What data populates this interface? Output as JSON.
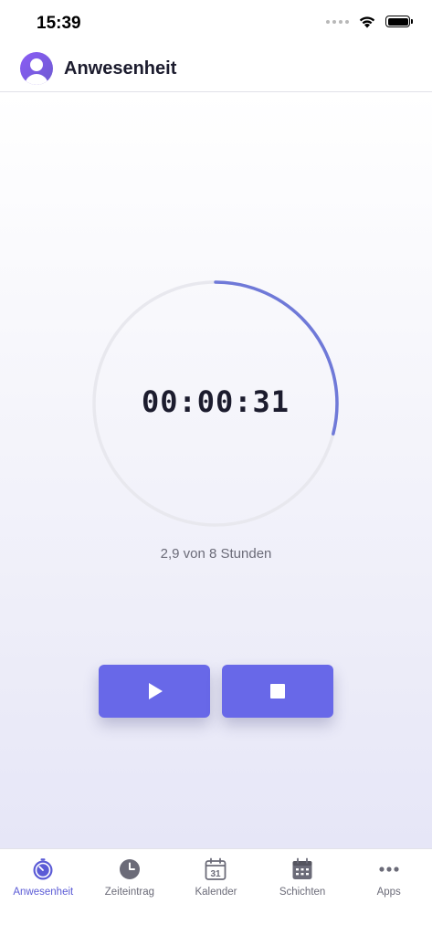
{
  "status_bar": {
    "time": "15:39"
  },
  "header": {
    "title": "Anwesenheit",
    "avatar_icon": "user-avatar-icon"
  },
  "timer": {
    "elapsed": "00:00:31",
    "progress_text": "2,9 von 8 Stunden",
    "ring_progress_fraction": 0.29,
    "ring_color": "#6f79d8",
    "track_color": "#e8e8ee"
  },
  "controls": {
    "play_icon": "play-icon",
    "stop_icon": "stop-icon",
    "button_color": "#6868e8"
  },
  "tabs": [
    {
      "label": "Anwesenheit",
      "icon": "timer-icon",
      "active": true
    },
    {
      "label": "Zeiteintrag",
      "icon": "clock-icon",
      "active": false
    },
    {
      "label": "Kalender",
      "icon": "calendar-31-icon",
      "active": false
    },
    {
      "label": "Schichten",
      "icon": "calendar-grid-icon",
      "active": false
    },
    {
      "label": "Apps",
      "icon": "more-dots-icon",
      "active": false
    }
  ],
  "calendar_day": "31",
  "accent_color": "#5b5bd6"
}
